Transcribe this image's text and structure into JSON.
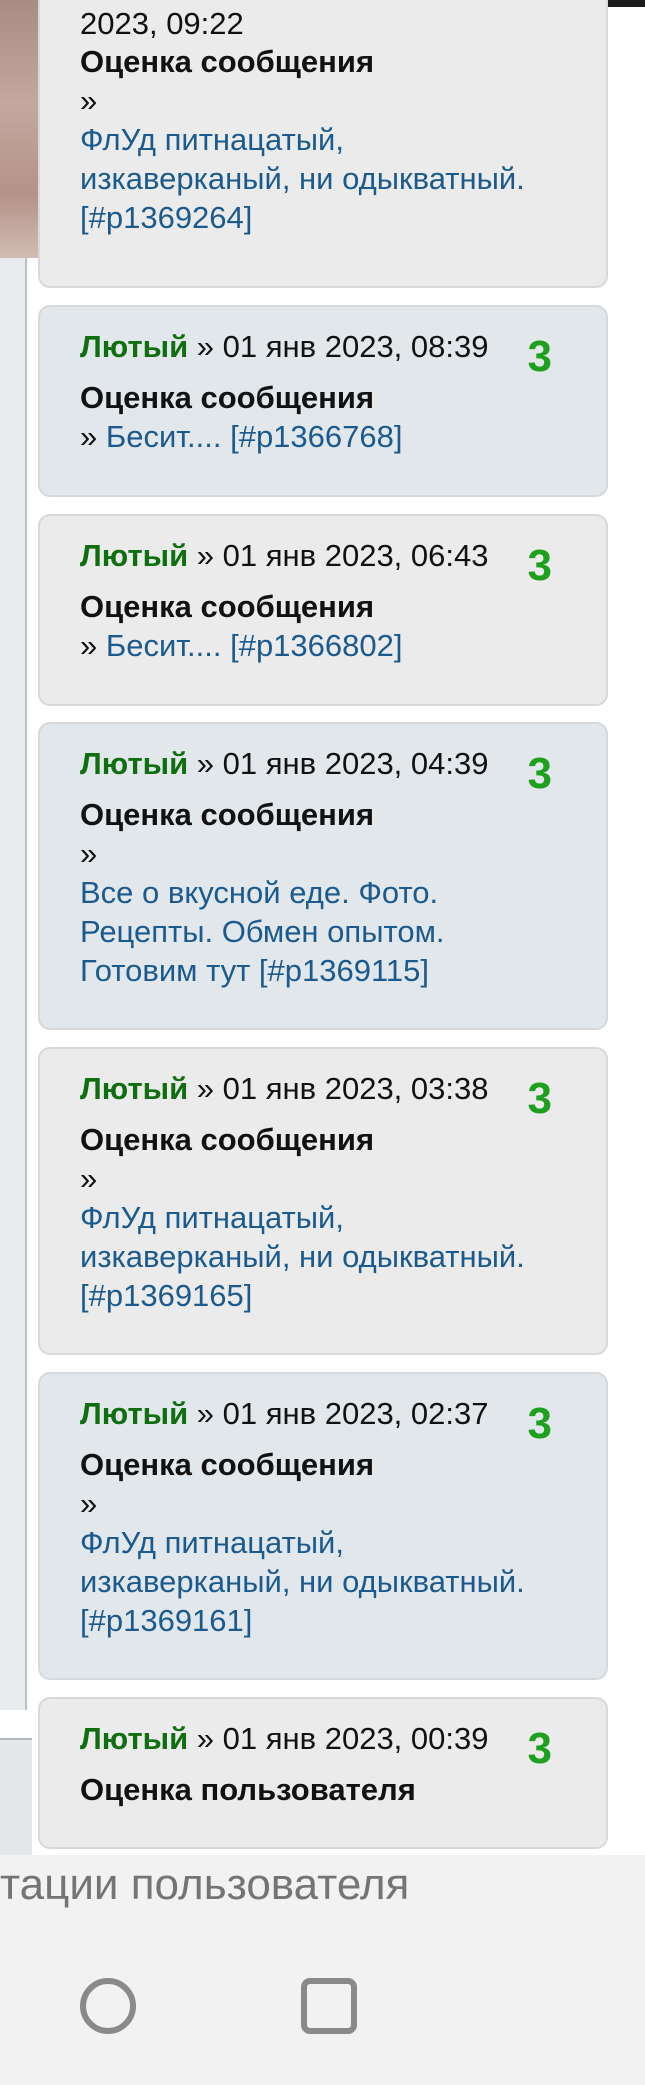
{
  "notifications": [
    {
      "date_partial": "2023, 09:22",
      "title": "Оценка сообщения",
      "raquo": "»",
      "link_lines": [
        "ФлУд питнацатый,",
        "изкаверканый, ни одыкватный.",
        "[#p1369264]"
      ]
    },
    {
      "author": "Лютый",
      "meta": " » 01 янв 2023, 08:39",
      "score": "3",
      "title": "Оценка сообщения",
      "raquo": "» ",
      "link": "Бесит.... [#p1366768]"
    },
    {
      "author": "Лютый",
      "meta": " » 01 янв 2023, 06:43",
      "score": "3",
      "title": "Оценка сообщения",
      "raquo": "» ",
      "link": "Бесит.... [#p1366802]"
    },
    {
      "author": "Лютый",
      "meta": " » 01 янв 2023, 04:39",
      "score": "3",
      "title": "Оценка сообщения",
      "raquo": "»",
      "link_lines": [
        "Все о вкусной еде. Фото.",
        "Рецепты. Обмен опытом.",
        "Готовим тут [#p1369115]"
      ]
    },
    {
      "author": "Лютый",
      "meta": " » 01 янв 2023, 03:38",
      "score": "3",
      "title": "Оценка сообщения",
      "raquo": "»",
      "link_lines": [
        "ФлУд питнацатый,",
        "изкаверканый, ни одыкватный.",
        "[#p1369165]"
      ]
    },
    {
      "author": "Лютый",
      "meta": " » 01 янв 2023, 02:37",
      "score": "3",
      "title": "Оценка сообщения",
      "raquo": "»",
      "link_lines": [
        "ФлУд питнацатый,",
        "изкаверканый, ни одыкватный.",
        "[#p1369161]"
      ]
    },
    {
      "author": "Лютый",
      "meta": " » 01 янв 2023, 00:39",
      "score": "3",
      "title": "Оценка пользователя"
    }
  ],
  "bottom_tab_text": "тации пользователя",
  "colors": {
    "author": "#0f6e0f",
    "score": "#1ea01e",
    "link": "#1b5a8e"
  },
  "icons": [
    "home-circle-icon",
    "recents-square-icon"
  ]
}
